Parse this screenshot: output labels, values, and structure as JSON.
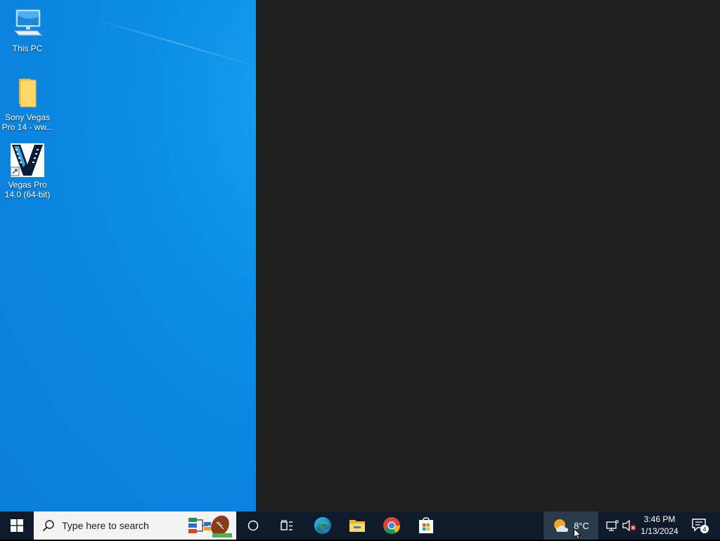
{
  "desktop": {
    "icons": [
      {
        "label_line1": "This PC",
        "label_line2": "",
        "icon": "computer-icon"
      },
      {
        "label_line1": "Sony Vegas",
        "label_line2": "Pro 14 - ww...",
        "icon": "folder-icon"
      },
      {
        "label_line1": "Vegas Pro",
        "label_line2": "14.0 (64-bit)",
        "icon": "vegas-pro-icon"
      }
    ]
  },
  "taskbar": {
    "start_icon": "windows-logo-icon",
    "search": {
      "placeholder": "Type here to search",
      "icon": "search-icon"
    },
    "pinned": [
      {
        "name": "cortana",
        "icon": "circle-icon"
      },
      {
        "name": "task-view",
        "icon": "task-view-icon"
      },
      {
        "name": "edge",
        "icon": "edge-icon"
      },
      {
        "name": "file-explorer",
        "icon": "file-explorer-icon"
      },
      {
        "name": "chrome",
        "icon": "chrome-icon"
      },
      {
        "name": "microsoft-store",
        "icon": "store-icon"
      }
    ],
    "weather": {
      "temp": "8°C",
      "icon": "partly-cloudy-icon"
    },
    "tray": {
      "network_icon": "network-icon",
      "volume_icon": "volume-muted-icon"
    },
    "clock": {
      "time": "3:46 PM",
      "date": "1/13/2024"
    },
    "notifications": {
      "count": "4",
      "icon": "action-center-icon"
    }
  },
  "colors": {
    "desktop_blue": "#0c8fe6",
    "dark_pane": "#202020",
    "taskbar": "#0f1b2a"
  }
}
